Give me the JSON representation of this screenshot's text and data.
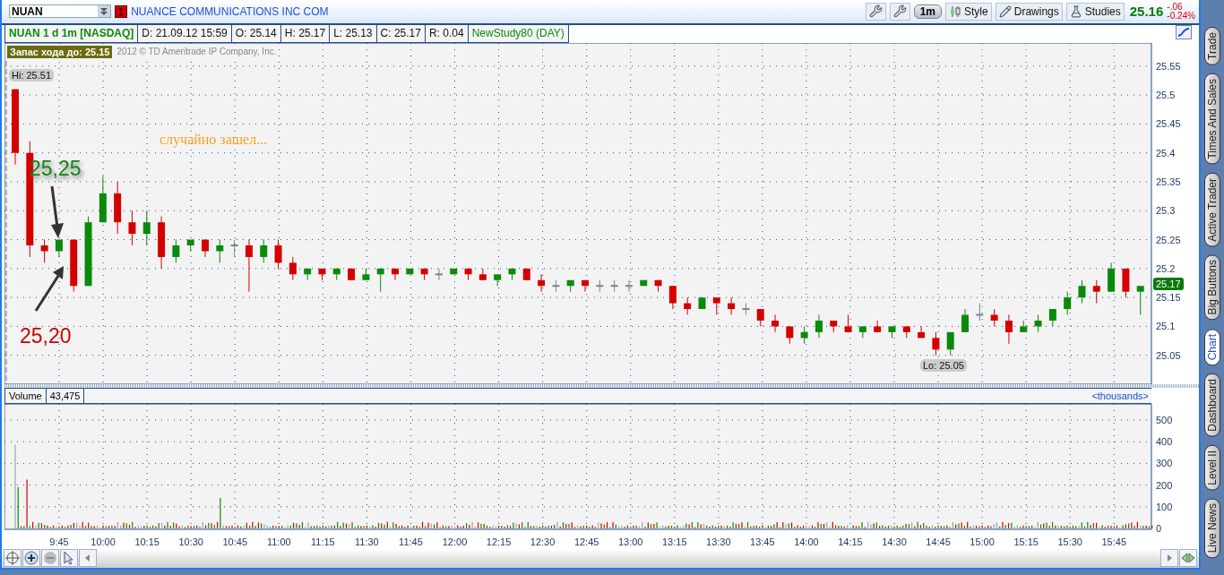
{
  "symbol": {
    "value": "NUAN",
    "badge": "1",
    "company": "NUANCE COMMUNICATIONS INC COM"
  },
  "toolbar": {
    "interval": "1m",
    "buttons": [
      {
        "kind": "style",
        "label": "Style"
      },
      {
        "kind": "drawings",
        "label": "Drawings"
      },
      {
        "kind": "studies",
        "label": "Studies"
      }
    ]
  },
  "quote": {
    "last": "25.16",
    "change": "-.06",
    "change_pct": "-0.24%"
  },
  "info_cells": [
    {
      "kind": "symbol",
      "text": "NUAN 1 d 1m [NASDAQ]"
    },
    {
      "kind": "field",
      "text": "D: 21.09.12 15:59"
    },
    {
      "kind": "field",
      "text": "O: 25.14"
    },
    {
      "kind": "field",
      "text": "H: 25.17"
    },
    {
      "kind": "field",
      "text": "L: 25.13"
    },
    {
      "kind": "field",
      "text": "C: 25.17"
    },
    {
      "kind": "field",
      "text": "R: 0.04"
    },
    {
      "kind": "study",
      "text": "NewStudy80 (DAY)"
    }
  ],
  "price_chart": {
    "badge": "Запас хода до: 25.15",
    "copyright": "2012 © TD Ameritrade IP Company, Inc.",
    "hi_label": "Hi: 25.51",
    "lo_label": "Lo: 25.05",
    "last_tag": "25.17",
    "notes": [
      {
        "kind": "comment",
        "text": "случайно зашел..."
      },
      {
        "kind": "upper",
        "text": "25,25"
      },
      {
        "kind": "lower",
        "text": "25,20"
      }
    ],
    "chart_data": {
      "type": "candlestick",
      "categories": [
        null,
        null,
        null,
        null,
        null,
        null,
        null,
        null,
        null,
        null,
        null,
        null,
        null,
        null,
        null,
        null,
        null,
        null,
        null,
        null,
        null,
        null,
        null,
        null,
        null,
        null,
        null,
        null,
        null,
        null,
        null,
        null,
        null,
        null,
        null,
        null,
        null,
        null,
        null,
        null,
        null,
        null,
        null,
        null,
        null,
        null,
        null,
        null,
        null,
        null,
        null,
        null,
        null,
        null,
        null,
        null,
        null,
        null,
        null,
        null,
        null,
        null,
        null,
        null,
        null,
        null,
        null,
        null,
        null,
        null,
        null,
        null,
        null,
        null,
        null,
        null,
        null,
        null
      ],
      "yticks": [
        25.55,
        25.5,
        25.45,
        25.4,
        25.35,
        25.3,
        25.25,
        25.2,
        25.15,
        25.1,
        25.05
      ],
      "ylim": [
        25.0,
        25.59
      ],
      "grid": true,
      "ohlc": [
        [
          25.51,
          25.51,
          25.38,
          25.4
        ],
        [
          25.4,
          25.42,
          25.22,
          25.24
        ],
        [
          25.24,
          25.25,
          25.21,
          25.23
        ],
        [
          25.23,
          25.25,
          25.22,
          25.25
        ],
        [
          25.25,
          25.25,
          25.16,
          25.17
        ],
        [
          25.17,
          25.29,
          25.17,
          25.28
        ],
        [
          25.28,
          25.36,
          25.28,
          25.33
        ],
        [
          25.33,
          25.35,
          25.26,
          25.28
        ],
        [
          25.28,
          25.3,
          25.24,
          25.26
        ],
        [
          25.26,
          25.3,
          25.24,
          25.28
        ],
        [
          25.28,
          25.29,
          25.2,
          25.22
        ],
        [
          25.22,
          25.25,
          25.21,
          25.24
        ],
        [
          25.24,
          25.25,
          25.23,
          25.25
        ],
        [
          25.25,
          25.25,
          25.22,
          25.23
        ],
        [
          25.23,
          25.25,
          25.21,
          25.24
        ],
        [
          25.24,
          25.25,
          25.22,
          25.24
        ],
        [
          25.24,
          25.25,
          25.16,
          25.22
        ],
        [
          25.22,
          25.25,
          25.21,
          25.24
        ],
        [
          25.24,
          25.25,
          25.2,
          25.21
        ],
        [
          25.21,
          25.22,
          25.18,
          25.19
        ],
        [
          25.19,
          25.2,
          25.18,
          25.2
        ],
        [
          25.2,
          25.2,
          25.18,
          25.19
        ],
        [
          25.19,
          25.2,
          25.18,
          25.2
        ],
        [
          25.2,
          25.2,
          25.18,
          25.18
        ],
        [
          25.18,
          25.2,
          25.18,
          25.19
        ],
        [
          25.19,
          25.2,
          25.16,
          25.2
        ],
        [
          25.2,
          25.2,
          25.18,
          25.19
        ],
        [
          25.19,
          25.2,
          25.19,
          25.2
        ],
        [
          25.2,
          25.2,
          25.18,
          25.19
        ],
        [
          25.19,
          25.2,
          25.18,
          25.19
        ],
        [
          25.19,
          25.2,
          25.19,
          25.2
        ],
        [
          25.2,
          25.2,
          25.18,
          25.19
        ],
        [
          25.19,
          25.2,
          25.18,
          25.18
        ],
        [
          25.18,
          25.19,
          25.17,
          25.19
        ],
        [
          25.19,
          25.2,
          25.18,
          25.2
        ],
        [
          25.2,
          25.2,
          25.18,
          25.18
        ],
        [
          25.18,
          25.19,
          25.16,
          25.17
        ],
        [
          25.17,
          25.18,
          25.16,
          25.17
        ],
        [
          25.17,
          25.18,
          25.16,
          25.18
        ],
        [
          25.18,
          25.18,
          25.16,
          25.17
        ],
        [
          25.17,
          25.18,
          25.16,
          25.17
        ],
        [
          25.17,
          25.18,
          25.16,
          25.17
        ],
        [
          25.17,
          25.18,
          25.16,
          25.17
        ],
        [
          25.17,
          25.18,
          25.17,
          25.18
        ],
        [
          25.18,
          25.18,
          25.16,
          25.17
        ],
        [
          25.17,
          25.17,
          25.13,
          25.14
        ],
        [
          25.14,
          25.15,
          25.12,
          25.13
        ],
        [
          25.13,
          25.15,
          25.13,
          25.15
        ],
        [
          25.15,
          25.15,
          25.12,
          25.14
        ],
        [
          25.14,
          25.15,
          25.12,
          25.13
        ],
        [
          25.13,
          25.14,
          25.12,
          25.13
        ],
        [
          25.13,
          25.13,
          25.1,
          25.11
        ],
        [
          25.11,
          25.12,
          25.09,
          25.1
        ],
        [
          25.1,
          25.1,
          25.07,
          25.08
        ],
        [
          25.08,
          25.1,
          25.07,
          25.09
        ],
        [
          25.09,
          25.12,
          25.08,
          25.11
        ],
        [
          25.11,
          25.11,
          25.09,
          25.1
        ],
        [
          25.1,
          25.12,
          25.09,
          25.09
        ],
        [
          25.09,
          25.1,
          25.08,
          25.1
        ],
        [
          25.1,
          25.11,
          25.09,
          25.09
        ],
        [
          25.09,
          25.1,
          25.08,
          25.1
        ],
        [
          25.1,
          25.1,
          25.08,
          25.09
        ],
        [
          25.09,
          25.1,
          25.08,
          25.08
        ],
        [
          25.08,
          25.09,
          25.05,
          25.06
        ],
        [
          25.06,
          25.09,
          25.05,
          25.09
        ],
        [
          25.09,
          25.13,
          25.09,
          25.12
        ],
        [
          25.12,
          25.14,
          25.11,
          25.12
        ],
        [
          25.12,
          25.13,
          25.1,
          25.11
        ],
        [
          25.11,
          25.12,
          25.07,
          25.09
        ],
        [
          25.09,
          25.11,
          25.09,
          25.1
        ],
        [
          25.1,
          25.12,
          25.09,
          25.11
        ],
        [
          25.11,
          25.13,
          25.1,
          25.13
        ],
        [
          25.13,
          25.16,
          25.12,
          25.15
        ],
        [
          25.15,
          25.18,
          25.14,
          25.17
        ],
        [
          25.17,
          25.18,
          25.14,
          25.16
        ],
        [
          25.16,
          25.21,
          25.16,
          25.2
        ],
        [
          25.2,
          25.2,
          25.15,
          25.16
        ],
        [
          25.16,
          25.17,
          25.12,
          25.17
        ]
      ]
    }
  },
  "time_labels": [
    "9:45",
    "10:00",
    "10:15",
    "10:30",
    "10:45",
    "11:00",
    "11:15",
    "11:30",
    "11:45",
    "12:00",
    "12:15",
    "12:30",
    "12:45",
    "13:00",
    "13:15",
    "13:30",
    "13:45",
    "14:00",
    "14:15",
    "14:30",
    "14:45",
    "15:00",
    "15:15",
    "15:30",
    "15:45"
  ],
  "volume": {
    "label": "Volume",
    "value": "43,475",
    "units": "<thousands>",
    "y_labels": [
      "500",
      "400",
      "300",
      "200",
      "100",
      "0"
    ]
  },
  "side_tabs": [
    {
      "label": "Trade",
      "selected": false
    },
    {
      "label": "Times And Sales",
      "selected": false
    },
    {
      "label": "Active Trader",
      "selected": false
    },
    {
      "label": "Big Buttons",
      "selected": false
    },
    {
      "label": "Chart",
      "selected": true
    },
    {
      "label": "Dashboard",
      "selected": false
    },
    {
      "label": "Level II",
      "selected": false
    },
    {
      "label": "Live News",
      "selected": false
    }
  ]
}
